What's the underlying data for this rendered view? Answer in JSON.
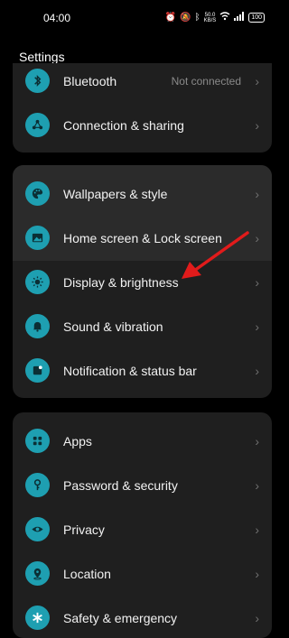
{
  "status_bar": {
    "time": "04:00",
    "network_speed": "50.0\nKB/S",
    "battery": "100",
    "icons": [
      "alarm-icon",
      "mute-icon",
      "bluetooth-icon",
      "wifi-icon",
      "signal-icon",
      "battery-icon"
    ]
  },
  "header": {
    "title": "Settings"
  },
  "group1": [
    {
      "label": "Bluetooth",
      "value": "Not connected",
      "icon": "bluetooth-icon"
    },
    {
      "label": "Connection & sharing",
      "icon": "connection-sharing-icon"
    }
  ],
  "group2": [
    {
      "label": "Wallpapers & style",
      "icon": "palette-icon"
    },
    {
      "label": "Home screen & Lock screen",
      "icon": "image-icon"
    },
    {
      "label": "Display & brightness",
      "icon": "brightness-icon"
    },
    {
      "label": "Sound & vibration",
      "icon": "bell-icon"
    },
    {
      "label": "Notification & status bar",
      "icon": "notification-icon"
    }
  ],
  "group3": [
    {
      "label": "Apps",
      "icon": "apps-grid-icon"
    },
    {
      "label": "Password & security",
      "icon": "key-icon"
    },
    {
      "label": "Privacy",
      "icon": "privacy-eye-icon"
    },
    {
      "label": "Location",
      "icon": "location-icon"
    },
    {
      "label": "Safety & emergency",
      "icon": "asterisk-icon"
    }
  ],
  "colors": {
    "accent": "#1e9fb1",
    "card": "#1f1f1f",
    "highlight": "#2b2b2b",
    "annotation_arrow": "#e11b1b"
  }
}
